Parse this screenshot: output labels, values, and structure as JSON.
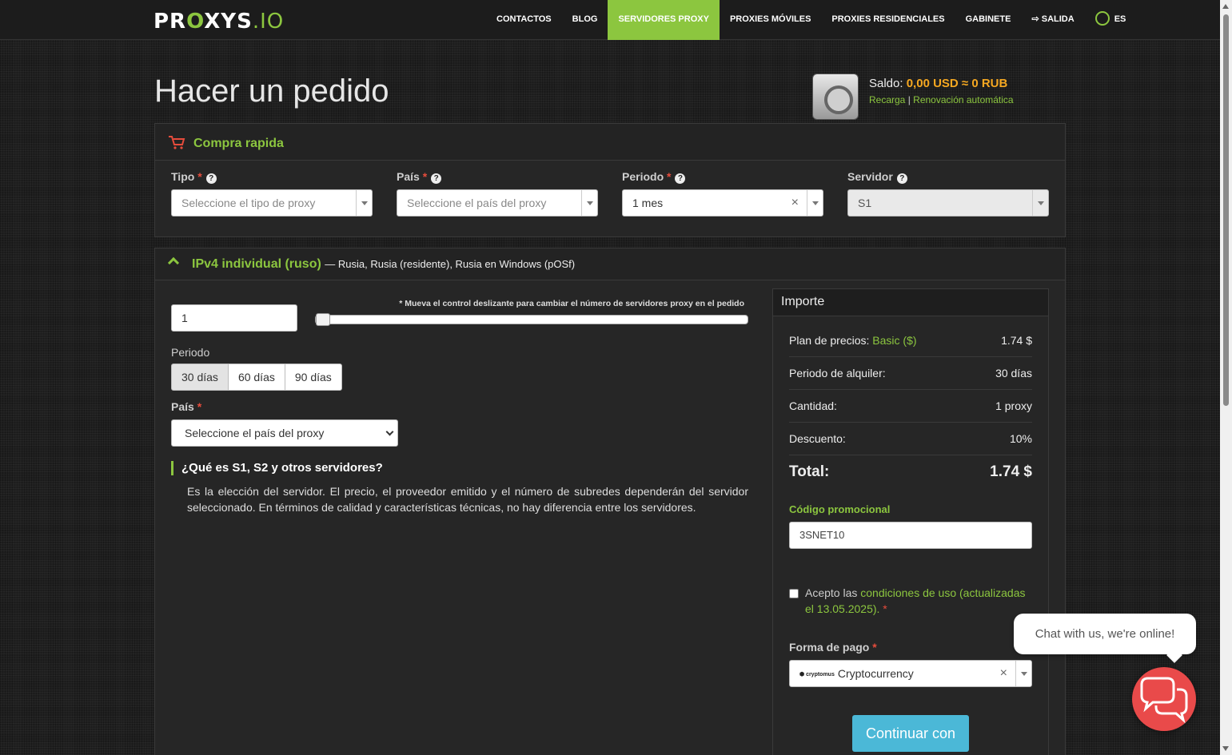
{
  "header": {
    "logo_pre": "PR",
    "logo_o": "O",
    "logo_mid": "XYS",
    "logo_io": ".IO",
    "nav": [
      "CONTACTOS",
      "BLOG",
      "SERVIDORES PROXY",
      "PROXIES MÓVILES",
      "PROXIES RESIDENCIALES",
      "GABINETE",
      "SALIDA",
      "ES"
    ]
  },
  "page_title": "Hacer un pedido",
  "balance": {
    "label": "Saldo:",
    "amount": "0,00 USD ≈ 0 RUB",
    "recharge": "Recarga",
    "separator": "|",
    "auto_renew": "Renovación automática"
  },
  "quick_buy": {
    "title": "Compra rapida",
    "tipo_label": "Tipo",
    "tipo_placeholder": "Seleccione el tipo de proxy",
    "pais_label": "País",
    "pais_placeholder": "Seleccione el país del proxy",
    "periodo_label": "Periodo",
    "periodo_value": "1 mes",
    "servidor_label": "Servidor",
    "servidor_value": "S1",
    "required_mark": "*",
    "clear": "×"
  },
  "product": {
    "title": "IPv4 individual (ruso)",
    "subtitle": "— Rusia, Rusia (residente), Rusia en Windows (pOSf)",
    "quantity": "1",
    "slider_hint": "* Mueva el control deslizante para cambiar el número de servidores proxy en el pedido",
    "periodo_label": "Periodo",
    "periods": [
      "30 días",
      "60 días",
      "90 días"
    ],
    "pais_label": "País",
    "pais_placeholder": "Seleccione el país del proxy",
    "faq_question": "¿Qué es S1, S2 y otros servidores?",
    "faq_answer": "Es la elección del servidor. El precio, el proveedor emitido y el número de subredes dependerán del servidor seleccionado. En términos de calidad y características técnicas, no hay diferencia entre los servidores."
  },
  "summary": {
    "title": "Importe",
    "plan_label": "Plan de precios:",
    "plan_name": "Basic ($)",
    "plan_value": "1.74 $",
    "rental_label": "Periodo de alquiler:",
    "rental_value": "30 días",
    "qty_label": "Cantidad:",
    "qty_value": "1 proxy",
    "discount_label": "Descuento:",
    "discount_value": "10%",
    "total_label": "Total:",
    "total_value": "1.74 $",
    "promo_label": "Código promocional",
    "promo_value": "3SNET10",
    "terms_prefix": "Acepto las ",
    "terms_link": "condiciones de uso (actualizadas el 13.05.2025).",
    "terms_req": " *",
    "pay_label": "Forma de pago",
    "pay_brand": "cryptomus",
    "pay_value": "Cryptocurrency",
    "continue": "Continuar con"
  },
  "chat": {
    "bubble": "Chat with us, we're online!"
  },
  "colors": {
    "accent": "#8cc63f",
    "balance": "#f6a821",
    "required": "#e74c3c",
    "continue_button": "#4bb8d7",
    "chat_button": "#e94a4a"
  }
}
